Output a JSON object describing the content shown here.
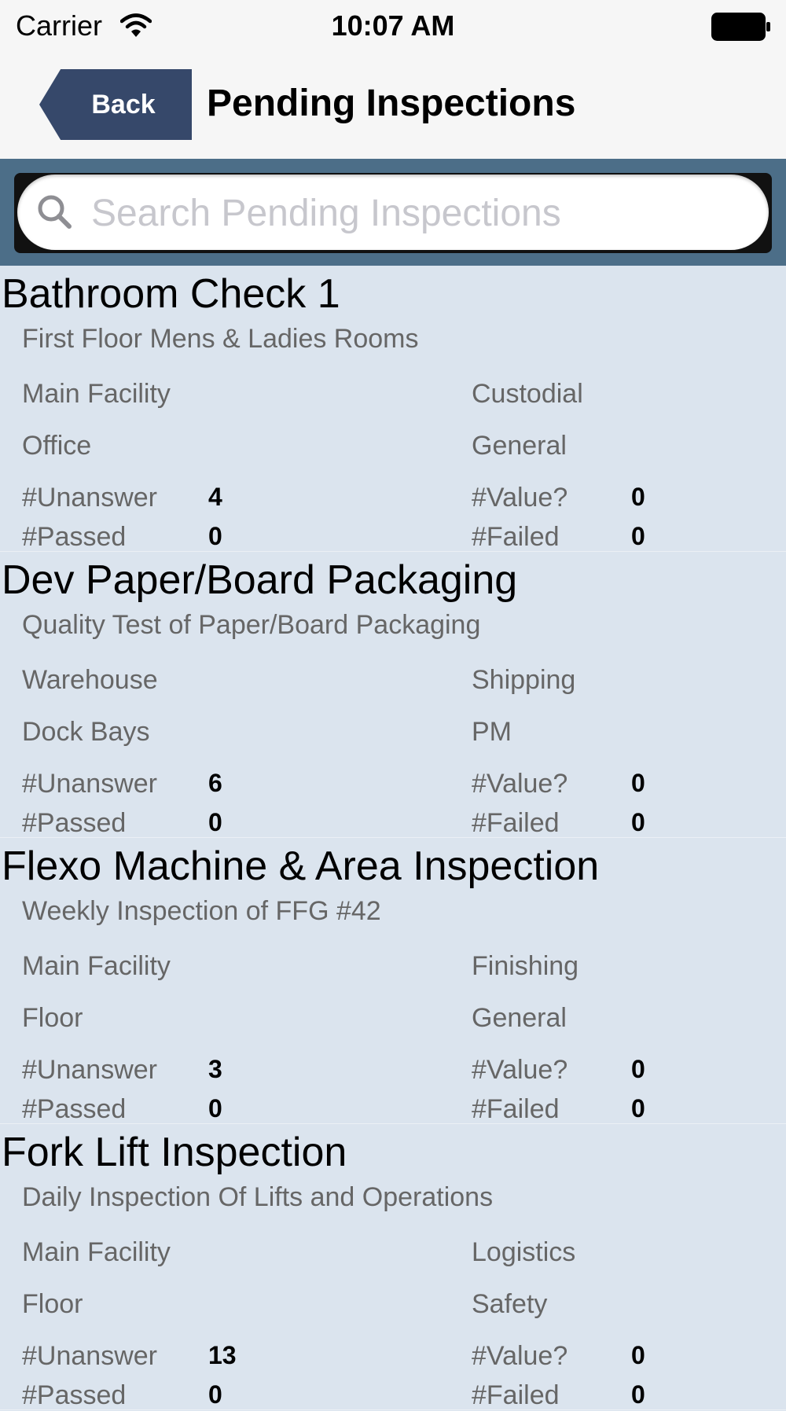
{
  "status_bar": {
    "carrier": "Carrier",
    "time": "10:07 AM",
    "icons": [
      "wifi-icon",
      "battery-icon"
    ]
  },
  "nav": {
    "back_label": "Back",
    "title": "Pending Inspections"
  },
  "search": {
    "placeholder": "Search Pending Inspections",
    "icon": "search-icon"
  },
  "labels": {
    "unanswered": "#Unanswer",
    "value": "#Value?",
    "passed": "#Passed",
    "failed": "#Failed"
  },
  "inspections": [
    {
      "title": "Bathroom Check 1",
      "subtitle": "First Floor Mens & Ladies Rooms",
      "facility": "Main Facility",
      "department": "Custodial",
      "area": "Office",
      "category": "General",
      "unanswered": "4",
      "value": "0",
      "passed": "0",
      "failed": "0"
    },
    {
      "title": "Dev Paper/Board Packaging",
      "subtitle": "Quality Test of Paper/Board Packaging",
      "facility": "Warehouse",
      "department": "Shipping",
      "area": "Dock Bays",
      "category": "PM",
      "unanswered": "6",
      "value": "0",
      "passed": "0",
      "failed": "0"
    },
    {
      "title": "Flexo Machine & Area Inspection",
      "subtitle": "Weekly Inspection of FFG #42",
      "facility": "Main Facility",
      "department": "Finishing",
      "area": "Floor",
      "category": "General",
      "unanswered": "3",
      "value": "0",
      "passed": "0",
      "failed": "0"
    },
    {
      "title": "Fork Lift Inspection",
      "subtitle": "Daily Inspection Of Lifts and Operations",
      "facility": "Main Facility",
      "department": "Logistics",
      "area": "Floor",
      "category": "Safety",
      "unanswered": "13",
      "value": "0",
      "passed": "0",
      "failed": "0"
    }
  ],
  "colors": {
    "nav_back": "#36486a",
    "search_bar": "#4c6e88",
    "list_background": "#dbe4ee"
  }
}
